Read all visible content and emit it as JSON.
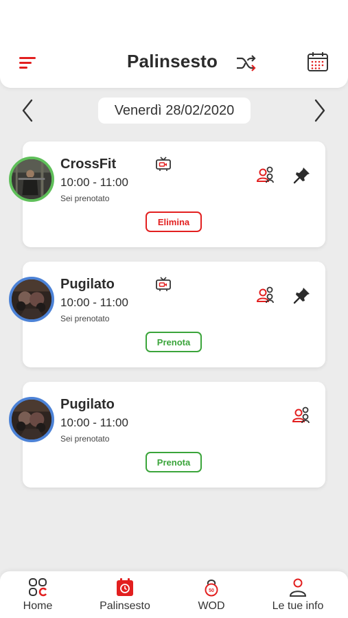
{
  "header": {
    "title": "Palinsesto",
    "icons": {
      "menu": "menu-icon",
      "shuffle": "shuffle-icon",
      "calendar": "calendar-icon"
    }
  },
  "date_nav": {
    "date": "Venerdì 28/02/2020",
    "prev_icon": "chevron-left-icon",
    "next_icon": "chevron-right-icon"
  },
  "classes": [
    {
      "name": "CrossFit",
      "time": "10:00 - 11:00",
      "status": "Sei prenotato",
      "action": "Elimina",
      "has_video": true,
      "has_pin": true,
      "ring": "#5fbf5a",
      "action_color": "#e21f1f"
    },
    {
      "name": "Pugilato",
      "time": "10:00 - 11:00",
      "status": "Sei prenotato",
      "action": "Prenota",
      "has_video": true,
      "has_pin": true,
      "ring": "#4c82d6",
      "action_color": "#3aa43a"
    },
    {
      "name": "Pugilato",
      "time": "10:00 - 11:00",
      "status": "Sei prenotato",
      "action": "Prenota",
      "has_video": false,
      "has_pin": false,
      "ring": "#4c82d6",
      "action_color": "#3aa43a"
    }
  ],
  "bottom_nav": {
    "items": [
      {
        "label": "Home",
        "icon": "home-grid-icon"
      },
      {
        "label": "Palinsesto",
        "icon": "calendar-clock-icon",
        "active": true
      },
      {
        "label": "WOD",
        "icon": "kettlebell-icon"
      },
      {
        "label": "Le tue info",
        "icon": "user-icon"
      }
    ]
  },
  "colors": {
    "accent": "#e21f1f",
    "success": "#3aa43a",
    "background": "#ececec"
  }
}
